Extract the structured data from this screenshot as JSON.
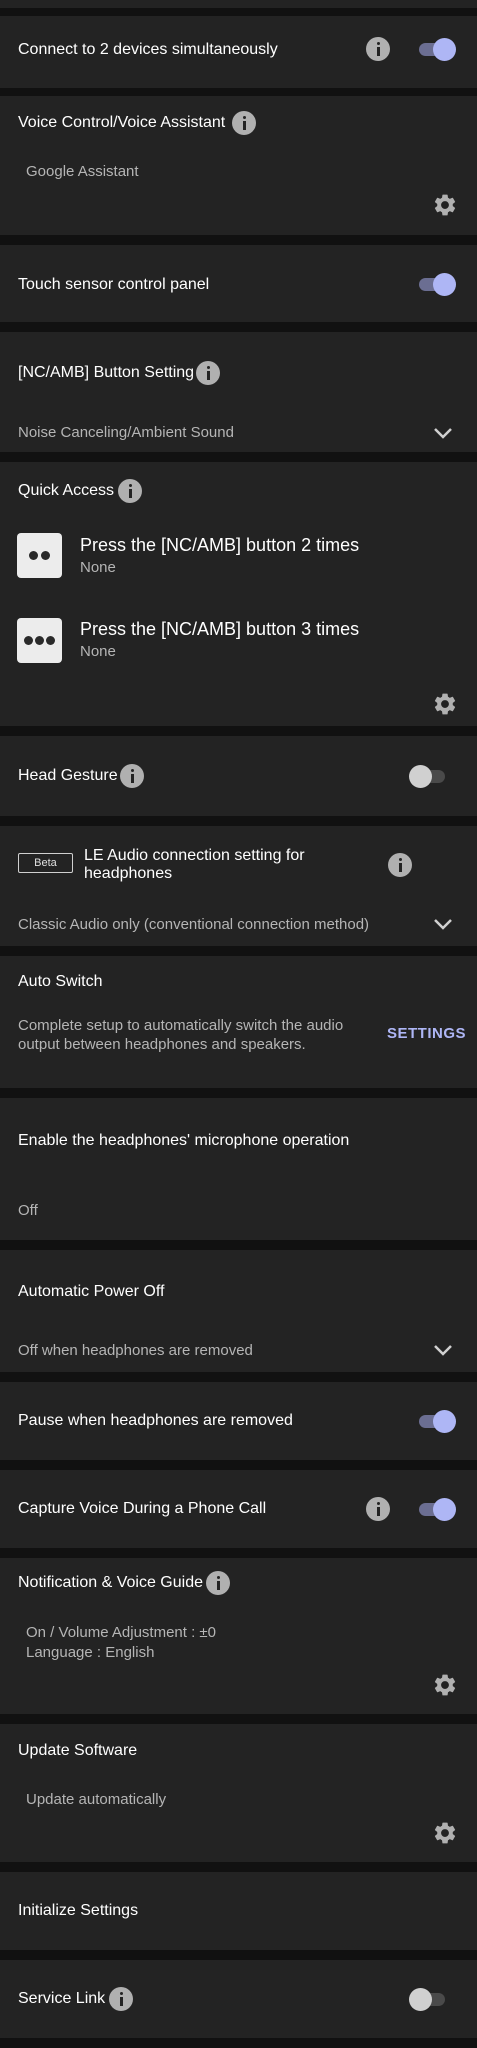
{
  "connect_two": {
    "label": "Connect to 2 devices simultaneously",
    "enabled": true
  },
  "voice_control": {
    "label": "Voice Control/Voice Assistant",
    "value": "Google Assistant"
  },
  "touch_sensor": {
    "label": "Touch sensor control panel",
    "enabled": true
  },
  "nc_amb": {
    "label": "[NC/AMB] Button Setting",
    "value": "Noise Canceling/Ambient Sound"
  },
  "quick_access": {
    "label": "Quick Access",
    "items": [
      {
        "title": "Press the [NC/AMB] button 2 times",
        "value": "None",
        "icon": "two-dots-icon"
      },
      {
        "title": "Press the [NC/AMB] button 3 times",
        "value": "None",
        "icon": "three-dots-icon"
      }
    ]
  },
  "head_gesture": {
    "label": "Head Gesture",
    "enabled": false
  },
  "le_audio": {
    "badge": "Beta",
    "label_line1": "LE Audio connection setting for",
    "label_line2": "headphones",
    "value": "Classic Audio only (conventional connection method)"
  },
  "auto_switch": {
    "label": "Auto Switch",
    "desc_line1": "Complete setup to automatically switch the audio",
    "desc_line2": "output between headphones and speakers.",
    "button": "SETTINGS"
  },
  "mic_operation": {
    "label": "Enable the headphones' microphone operation",
    "value": "Off"
  },
  "auto_power_off": {
    "label": "Automatic Power Off",
    "value": "Off when headphones are removed"
  },
  "pause_removed": {
    "label": "Pause when headphones are removed",
    "enabled": true
  },
  "capture_voice": {
    "label": "Capture Voice During a Phone Call",
    "enabled": true
  },
  "notification": {
    "label": "Notification & Voice Guide",
    "line1": "On / Volume Adjustment : ±0",
    "line2": "Language : English"
  },
  "update_software": {
    "label": "Update Software",
    "value": "Update automatically"
  },
  "initialize": {
    "label": "Initialize Settings"
  },
  "service_link": {
    "label": "Service Link",
    "enabled": false
  },
  "colors": {
    "background": "#111111",
    "card": "#232323",
    "accent": "#aeb6f5",
    "toggle_track_on": "#6b6e92",
    "secondary_text": "#b5b5b5"
  }
}
